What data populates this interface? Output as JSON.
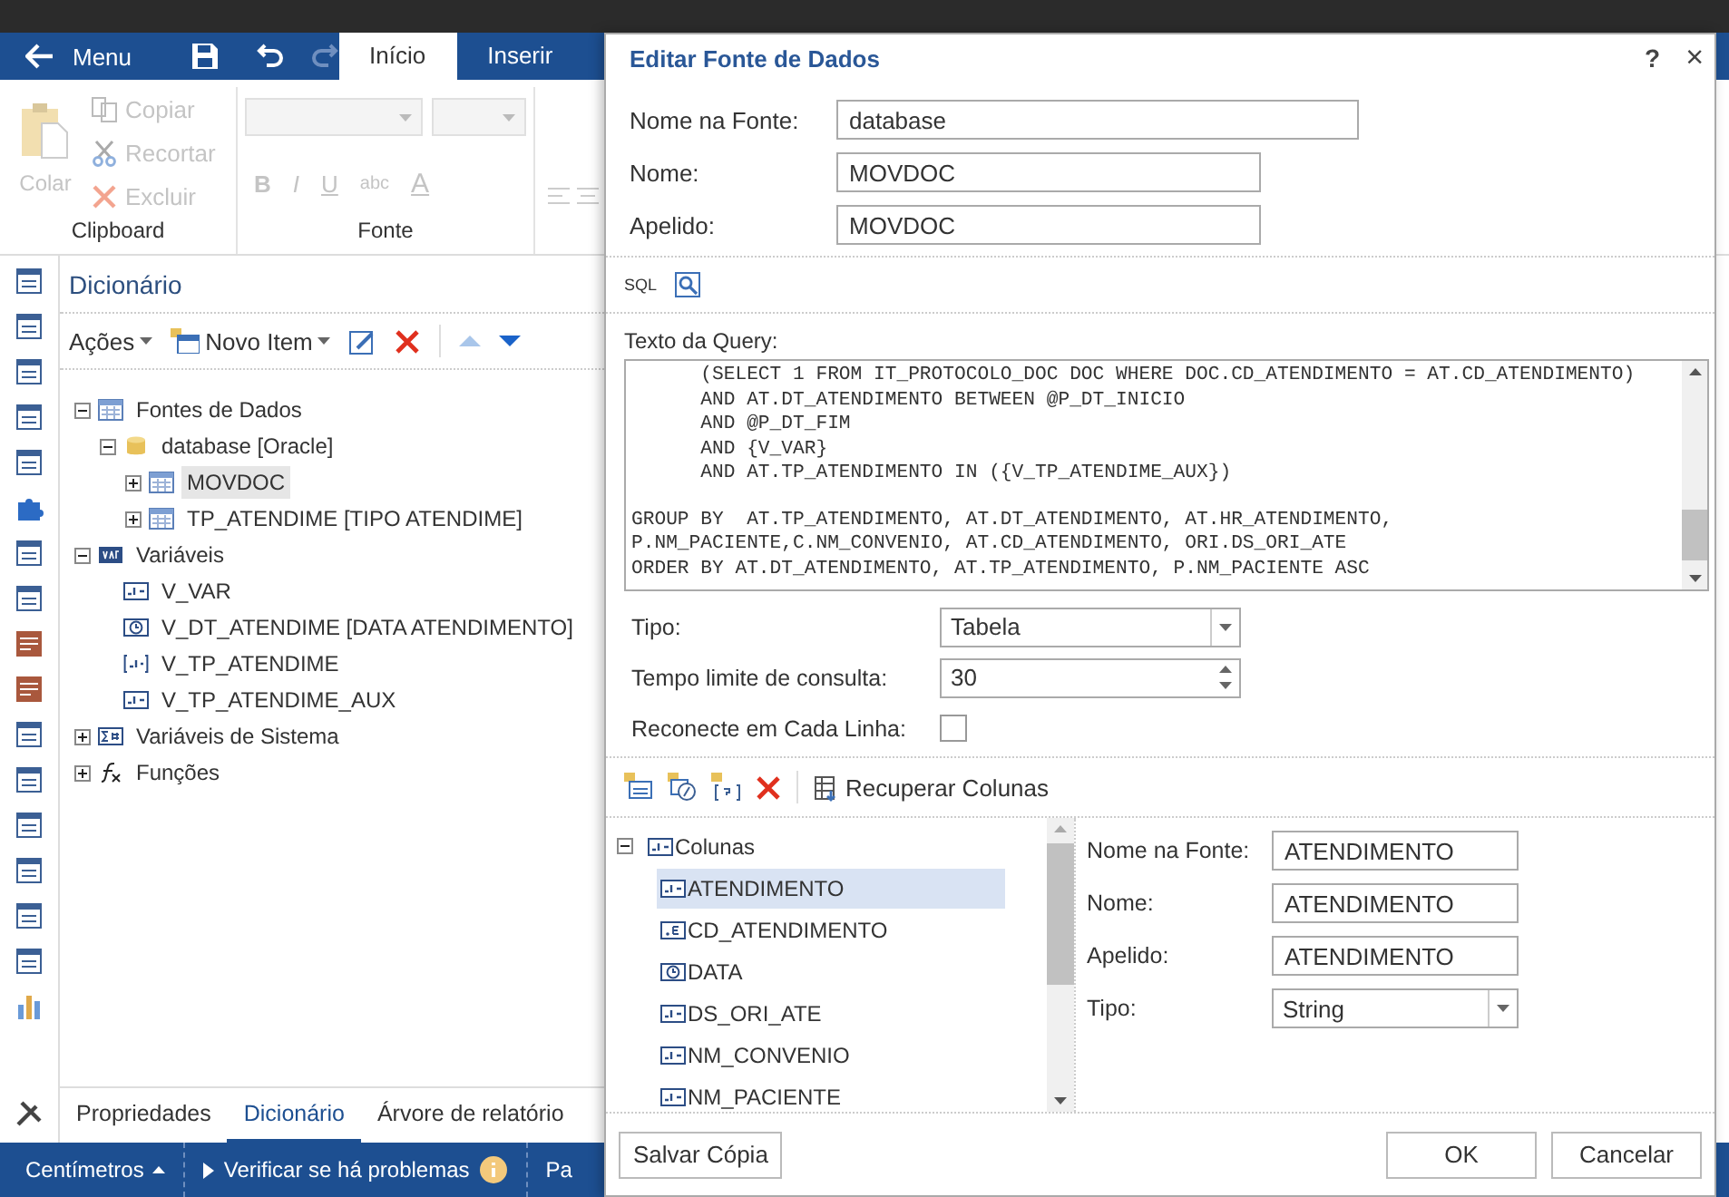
{
  "app_bar": {
    "menu_label": "Menu",
    "tabs": [
      {
        "label": "Início",
        "selected": true
      },
      {
        "label": "Inserir",
        "selected": false
      }
    ]
  },
  "ribbon": {
    "clipboard": {
      "label": "Clipboard",
      "paste": {
        "label": "Colar",
        "disabled": true
      },
      "actions": [
        {
          "label": "Copiar",
          "kind": "copy",
          "disabled": true
        },
        {
          "label": "Recortar",
          "kind": "cut",
          "disabled": true
        },
        {
          "label": "Excluir",
          "kind": "delete",
          "disabled": true
        }
      ]
    },
    "font": {
      "label": "Fonte",
      "format_buttons": [
        {
          "label": "B",
          "kind": "bold"
        },
        {
          "label": "I",
          "kind": "italic"
        },
        {
          "label": "U",
          "kind": "underline"
        },
        {
          "label": "abc",
          "kind": "strike"
        },
        {
          "label": "A",
          "kind": "color"
        }
      ]
    }
  },
  "dictionary": {
    "title": "Dicionário",
    "actions_label": "Ações",
    "new_item_label": "Novo Item",
    "tree": [
      {
        "label": "Fontes de Dados",
        "kind": "table",
        "expanded": true,
        "selected": false,
        "children": [
          {
            "label": "database [Oracle]",
            "kind": "database",
            "expanded": true,
            "selected": false,
            "children": [
              {
                "label": "MOVDOC",
                "kind": "table",
                "expanded": false,
                "selected": true
              },
              {
                "label": "TP_ATENDIME [TIPO ATENDIME]",
                "kind": "table",
                "expanded": false,
                "selected": false
              }
            ]
          }
        ]
      },
      {
        "label": "Variáveis",
        "kind": "var",
        "expanded": true,
        "selected": false,
        "children": [
          {
            "label": "V_VAR",
            "kind": "string",
            "selected": false
          },
          {
            "label": "V_DT_ATENDIME [DATA ATENDIMENTO]",
            "kind": "datetime",
            "selected": false
          },
          {
            "label": "V_TP_ATENDIME",
            "kind": "string-bracket",
            "selected": false
          },
          {
            "label": "V_TP_ATENDIME_AUX",
            "kind": "string",
            "selected": false
          }
        ]
      },
      {
        "label": "Variáveis de Sistema",
        "kind": "system",
        "expanded": false,
        "selected": false
      },
      {
        "label": "Funções",
        "kind": "function",
        "expanded": false,
        "selected": false
      }
    ]
  },
  "bottom_tabs": [
    {
      "label": "Propriedades",
      "selected": false
    },
    {
      "label": "Dicionário",
      "selected": true
    },
    {
      "label": "Árvore de relatório",
      "selected": false
    }
  ],
  "status_bar": {
    "units": "Centímetros",
    "check": "Verificar se há problemas",
    "cut_item": "Pa"
  },
  "dialog": {
    "title": "Editar Fonte de Dados",
    "help": "?",
    "close": "×",
    "fields": [
      {
        "label": "Nome na Fonte:",
        "value": "database"
      },
      {
        "label": "Nome:",
        "value": "MOVDOC"
      },
      {
        "label": "Apelido:",
        "value": "MOVDOC"
      }
    ],
    "sql_label": "SQL",
    "query_label": "Texto da Query:",
    "query_blocks": [
      [
        "      (SELECT 1 FROM IT_PROTOCOLO_DOC DOC WHERE DOC.CD_ATENDIMENTO = AT.CD_ATENDIMENTO)",
        "      AND AT.DT_ATENDIMENTO BETWEEN @P_DT_INICIO",
        "      AND @P_DT_FIM",
        "      AND {V_VAR}",
        "      AND AT.TP_ATENDIMENTO IN ({V_TP_ATENDIME_AUX})"
      ],
      [
        "GROUP BY  AT.TP_ATENDIMENTO, AT.DT_ATENDIMENTO, AT.HR_ATENDIMENTO,",
        "P.NM_PACIENTE,C.NM_CONVENIO, AT.CD_ATENDIMENTO, ORI.DS_ORI_ATE",
        "ORDER BY AT.DT_ATENDIMENTO, AT.TP_ATENDIMENTO, P.NM_PACIENTE ASC"
      ]
    ],
    "options": [
      {
        "kind": "select",
        "label": "Tipo:",
        "value": "Tabela"
      },
      {
        "kind": "spinner",
        "label": "Tempo limite de consulta:",
        "value": "30"
      },
      {
        "kind": "checkbox",
        "label": "Reconecte em Cada Linha:",
        "checked": false
      }
    ],
    "retrieve_label": "Recuperar Colunas",
    "columns_tree": [
      {
        "label": "Colunas",
        "kind": "string",
        "expanded": true,
        "selected": false,
        "children": [
          {
            "label": "ATENDIMENTO",
            "kind": "string",
            "selected": true
          },
          {
            "label": "CD_ATENDIMENTO",
            "kind": "number",
            "selected": false
          },
          {
            "label": "DATA",
            "kind": "datetime",
            "selected": false
          },
          {
            "label": "DS_ORI_ATE",
            "kind": "string",
            "selected": false
          },
          {
            "label": "NM_CONVENIO",
            "kind": "string",
            "selected": false
          },
          {
            "label": "NM_PACIENTE",
            "kind": "string",
            "selected": false
          }
        ]
      }
    ],
    "column_fields": [
      {
        "kind": "text",
        "label": "Nome na Fonte:",
        "value": "ATENDIMENTO"
      },
      {
        "kind": "text",
        "label": "Nome:",
        "value": "ATENDIMENTO"
      },
      {
        "kind": "text",
        "label": "Apelido:",
        "value": "ATENDIMENTO"
      },
      {
        "kind": "select",
        "label": "Tipo:",
        "value": "String"
      }
    ],
    "buttons": {
      "save_copy": "Salvar Cópia",
      "ok": "OK",
      "cancel": "Cancelar"
    }
  }
}
